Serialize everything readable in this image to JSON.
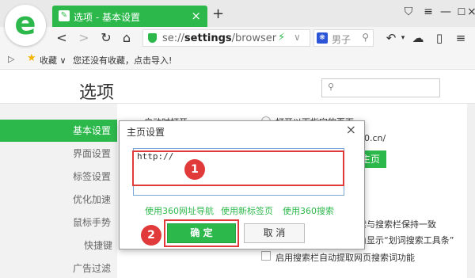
{
  "browser": {
    "tab_title": "选项 - 基本设置",
    "new_tab_symbol": "+",
    "address_scheme": "se://",
    "address_path": "settings",
    "address_suffix": "/browser",
    "search_text": "男子",
    "bookmarks_label": "收藏",
    "bookmarks_hint": "您还没有收藏，点击导入!"
  },
  "settings": {
    "title": "选项",
    "sidebar": [
      {
        "label": "基本设置",
        "active": true
      },
      {
        "label": "界面设置"
      },
      {
        "label": "标签设置"
      },
      {
        "label": "优化加速"
      },
      {
        "label": "鼠标手势"
      },
      {
        "label": "快捷键"
      },
      {
        "label": "广告过滤"
      }
    ],
    "background": {
      "section_label": "启动时打开",
      "radio_text": "打开以下指定的页面",
      "url_fragment": "0.cn/",
      "green_button": "主页",
      "row1": "索与搜索栏保持一致",
      "row2": "角显示“划词搜索工具条”",
      "checkbox_text": "启用搜索栏自动提取网页搜索词功能"
    }
  },
  "dialog": {
    "title": "主页设置",
    "input_value": "http://",
    "links": [
      "使用360网址导航",
      "使用新标签页",
      "使用360搜索"
    ],
    "ok_label": "确 定",
    "cancel_label": "取 消"
  },
  "annotations": {
    "badge_1": "1",
    "badge_2": "2",
    "color": "#e03a3a"
  },
  "colors": {
    "accent": "#2db84c"
  }
}
